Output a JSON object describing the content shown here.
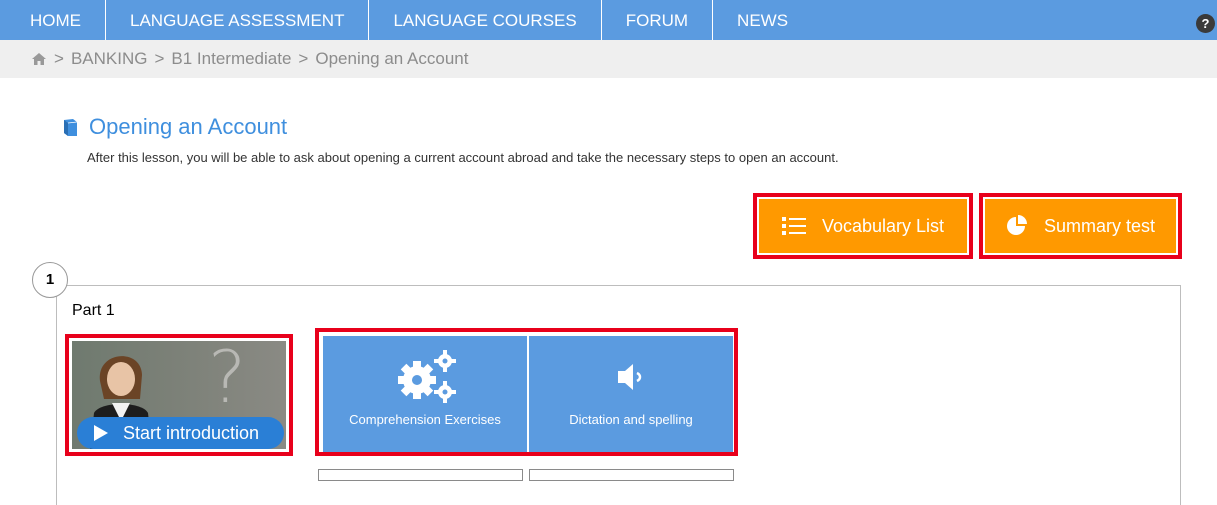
{
  "nav": {
    "items": [
      "HOME",
      "LANGUAGE ASSESSMENT",
      "LANGUAGE COURSES",
      "FORUM",
      "NEWS"
    ],
    "help_label": "?"
  },
  "breadcrumb": {
    "separator": ">",
    "items": [
      "BANKING",
      "B1 Intermediate",
      "Opening an Account"
    ]
  },
  "lesson": {
    "title": "Opening an Account",
    "description": "After this lesson, you will be able to ask about opening a current account abroad and take the necessary steps to open an account."
  },
  "actions": {
    "vocabulary_label": "Vocabulary List",
    "summary_label": "Summary test"
  },
  "part": {
    "number": "1",
    "title": "Part 1",
    "intro_label": "Start introduction",
    "exercises": [
      {
        "label": "Comprehension Exercises",
        "icon": "gears-icon"
      },
      {
        "label": "Dictation and spelling",
        "icon": "speaker-icon"
      }
    ]
  },
  "colors": {
    "nav_bg": "#5b9be0",
    "accent_orange": "#ff9900",
    "highlight_red": "#e8001b",
    "title_blue": "#3f8fde"
  }
}
